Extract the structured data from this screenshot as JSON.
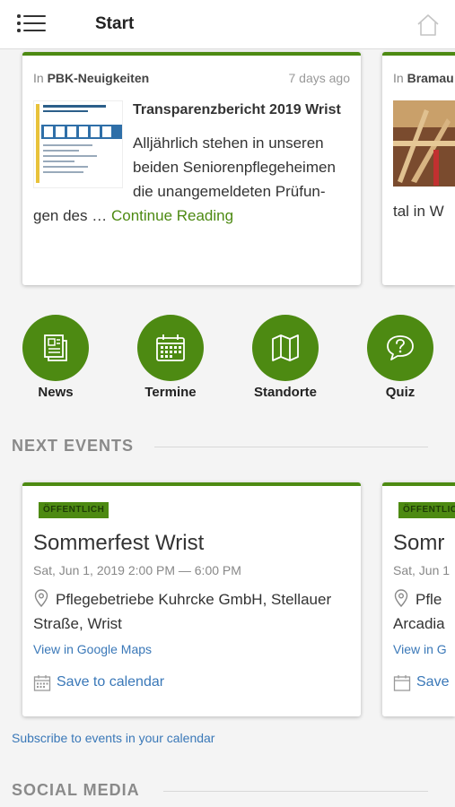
{
  "header": {
    "title": "Start"
  },
  "news": [
    {
      "prefix": "In",
      "source": "PBK-Neuigkeiten",
      "time": "7 days ago",
      "title": "Transparenzbericht 2019 Wrist",
      "excerpt_line1": "Alljährlich stehen in unseren beiden Seniorenpflegeheimen die unangemeldeten Prüfun-",
      "excerpt_line2": "gen des  …",
      "continue": "Continue Reading"
    },
    {
      "prefix": "In",
      "source": "Bramau",
      "excerpt": "tal in W"
    }
  ],
  "quick_links": [
    {
      "label": "News",
      "icon": "newspaper-icon"
    },
    {
      "label": "Termine",
      "icon": "calendar-icon"
    },
    {
      "label": "Standorte",
      "icon": "map-icon"
    },
    {
      "label": "Quiz",
      "icon": "quiz-icon"
    }
  ],
  "events_section": {
    "title": "NEXT EVENTS"
  },
  "events": [
    {
      "badge": "ÖFFENTLICH",
      "title": "Sommerfest Wrist",
      "time": "Sat, Jun 1, 2019 2:00 PM  —  6:00 PM",
      "location": "Pflegebetriebe Kuhrcke GmbH, Stellauer Straße, Wrist",
      "maps": "View in Google Maps",
      "save": "Save to calendar"
    },
    {
      "badge": "ÖFFENTLICH",
      "title": "Somr",
      "time": "Sat, Jun 1",
      "location": "Pfle Arcadia",
      "maps": "View in G",
      "save": "Save"
    }
  ],
  "subscribe": "Subscribe to events in your calendar",
  "social_section": {
    "title": "SOCIAL MEDIA"
  },
  "colors": {
    "accent": "#4d8a12",
    "link": "#3a78b8"
  }
}
